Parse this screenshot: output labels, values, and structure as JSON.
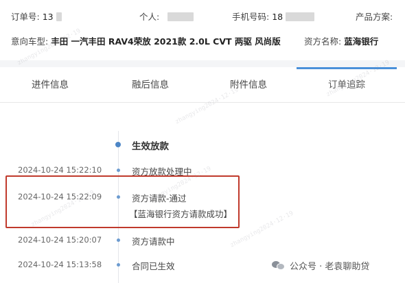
{
  "header": {
    "order_no_label": "订单号:",
    "order_no_value": "13",
    "person_label": "个人:",
    "phone_label": "手机号码:",
    "phone_value": "18",
    "product_label": "产品方案:",
    "vehicle_label": "意向车型:",
    "vehicle_value": "丰田 一汽丰田 RAV4荣放 2021款 2.0L CVT 两驱 风尚版",
    "funder_label": "资方名称:",
    "funder_value": "蓝海银行"
  },
  "tabs": [
    {
      "label": "进件信息",
      "active": false
    },
    {
      "label": "融后信息",
      "active": false
    },
    {
      "label": "附件信息",
      "active": false
    },
    {
      "label": "订单追踪",
      "active": true
    }
  ],
  "timeline": {
    "section_title": "生效放款",
    "events": [
      {
        "time": "2024-10-24 15:22:10",
        "text": "资方放款处理中"
      },
      {
        "time": "2024-10-24 15:22:09",
        "text": "资方请款-通过",
        "sub": "【蓝海银行资方请款成功】"
      },
      {
        "time": "2024-10-24 15:20:07",
        "text": "资方请款中"
      },
      {
        "time": "2024-10-24 15:13:58",
        "text": "合同已生效"
      }
    ]
  },
  "footer": {
    "wechat_label": "公众号 · 老袁聊助贷"
  },
  "colors": {
    "accent": "#4a90d9",
    "highlight_border": "#c0392b",
    "timeline_dot": "#4d86c6"
  }
}
